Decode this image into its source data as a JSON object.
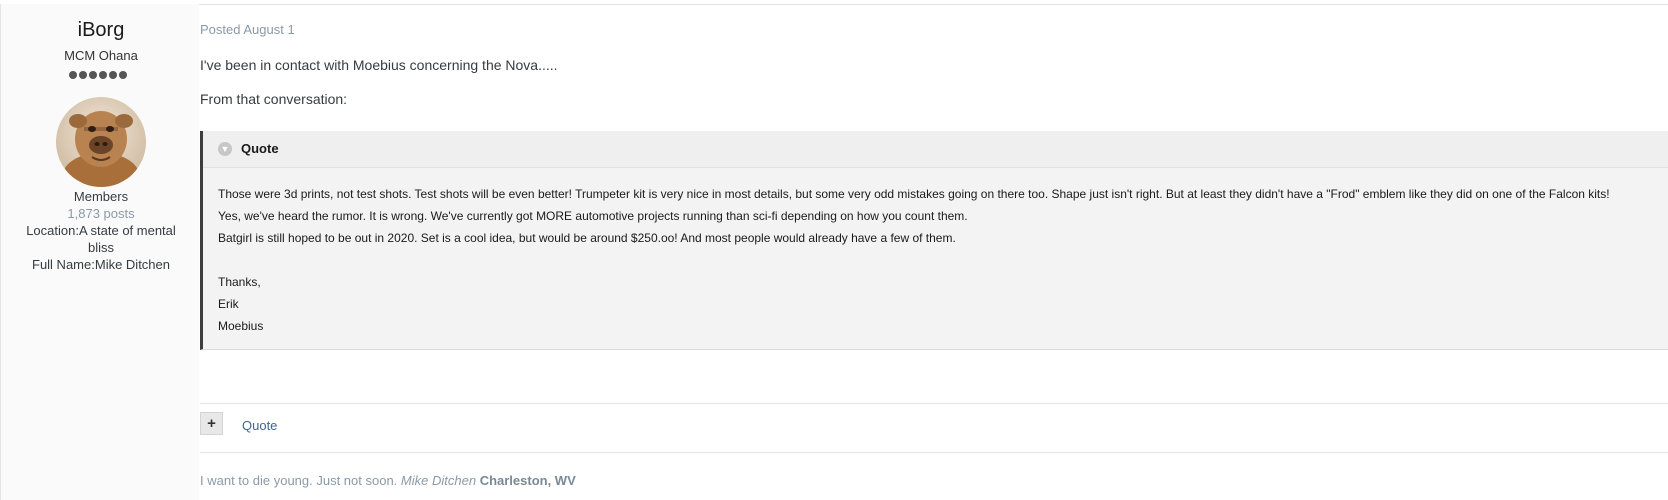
{
  "author": {
    "name": "iBorg",
    "group": "MCM Ohana",
    "rank_pips": 6,
    "role": "Members",
    "posts": "1,873 posts",
    "location_label": "Location:",
    "location_line1": "A state of mental",
    "location_line2": "bliss",
    "fullname_label": "Full Name:",
    "fullname": "Mike Ditchen"
  },
  "post": {
    "posted": "Posted August 1",
    "paragraph1": "I've been in contact with Moebius concerning the Nova.....",
    "paragraph2": "From that conversation:",
    "quote": {
      "title": "Quote",
      "lines": [
        "Those were 3d prints, not test shots.  Test shots will be even better!  Trumpeter kit is very nice in most details, but some very odd mistakes going on there too.  Shape just isn't right.  But at least they didn't have a \"Frod\" emblem like they did on one of the Falcon kits!",
        "Yes, we've heard the rumor.  It is wrong.  We've currently got MORE automotive projects running than sci-fi depending on how you count them.",
        "Batgirl is still hoped to be out in 2020.  Set is a cool idea, but would be around $250.oo!  And most people would already have a few of them.",
        "",
        "Thanks,",
        "Erik",
        "Moebius"
      ]
    }
  },
  "actions": {
    "plus_label": "+",
    "quote_label": "Quote"
  },
  "signature": {
    "text": "I want to die young. Just not soon.",
    "name": "Mike Ditchen",
    "location": "Charleston, WV"
  },
  "icons": {
    "quote_toggle": "chevron-down-icon",
    "plus": "plus-icon"
  },
  "colors": {
    "link": "#3d6594",
    "muted": "#8a9aa8",
    "quote_border": "#3d3d3d"
  }
}
